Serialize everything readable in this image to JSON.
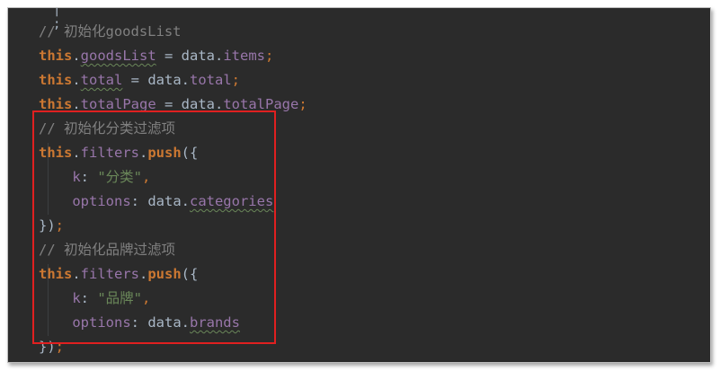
{
  "editor": {
    "lines": [
      {
        "id": "l1",
        "tokens": [
          {
            "c": "cm",
            "t": "// 初始化goodsList"
          }
        ]
      },
      {
        "id": "l2",
        "tokens": [
          {
            "c": "kw",
            "t": "this"
          },
          {
            "c": "pl",
            "t": "."
          },
          {
            "c": "pr sq",
            "t": "goodsList"
          },
          {
            "c": "pl",
            "t": " = data."
          },
          {
            "c": "pr",
            "t": "items"
          },
          {
            "c": "op",
            "t": ";"
          }
        ]
      },
      {
        "id": "l3",
        "tokens": [
          {
            "c": "kw",
            "t": "this"
          },
          {
            "c": "pl",
            "t": "."
          },
          {
            "c": "pr sq",
            "t": "total"
          },
          {
            "c": "pl",
            "t": " = data."
          },
          {
            "c": "pr",
            "t": "total"
          },
          {
            "c": "op",
            "t": ";"
          }
        ]
      },
      {
        "id": "l4",
        "tokens": [
          {
            "c": "kw",
            "t": "this"
          },
          {
            "c": "pl",
            "t": "."
          },
          {
            "c": "pr",
            "t": "totalPage"
          },
          {
            "c": "pl",
            "t": " = data."
          },
          {
            "c": "pr",
            "t": "totalPage"
          },
          {
            "c": "op",
            "t": ";"
          }
        ]
      },
      {
        "id": "l5",
        "tokens": [
          {
            "c": "cm",
            "t": "// 初始化分类过滤项"
          }
        ]
      },
      {
        "id": "l6",
        "tokens": [
          {
            "c": "kw",
            "t": "this"
          },
          {
            "c": "pl",
            "t": "."
          },
          {
            "c": "pr",
            "t": "filters"
          },
          {
            "c": "pl",
            "t": "."
          },
          {
            "c": "kw",
            "t": "push"
          },
          {
            "c": "pl",
            "t": "({"
          }
        ]
      },
      {
        "id": "l7",
        "tokens": [
          {
            "c": "pr",
            "t": "    k"
          },
          {
            "c": "pl",
            "t": ": "
          },
          {
            "c": "st",
            "t": "\"分类\""
          },
          {
            "c": "op",
            "t": ","
          }
        ]
      },
      {
        "id": "l8",
        "tokens": [
          {
            "c": "pr",
            "t": "    options"
          },
          {
            "c": "pl",
            "t": ": data."
          },
          {
            "c": "pr sq",
            "t": "categories"
          }
        ]
      },
      {
        "id": "l9",
        "tokens": [
          {
            "c": "pl",
            "t": "})"
          },
          {
            "c": "op",
            "t": ";"
          }
        ]
      },
      {
        "id": "l10",
        "tokens": [
          {
            "c": "cm",
            "t": "// 初始化品牌过滤项"
          }
        ]
      },
      {
        "id": "l11",
        "tokens": [
          {
            "c": "kw",
            "t": "this"
          },
          {
            "c": "pl",
            "t": "."
          },
          {
            "c": "pr",
            "t": "filters"
          },
          {
            "c": "pl",
            "t": "."
          },
          {
            "c": "kw",
            "t": "push"
          },
          {
            "c": "pl",
            "t": "({"
          }
        ]
      },
      {
        "id": "l12",
        "tokens": [
          {
            "c": "pr",
            "t": "    k"
          },
          {
            "c": "pl",
            "t": ": "
          },
          {
            "c": "st",
            "t": "\"品牌\""
          },
          {
            "c": "op",
            "t": ","
          }
        ]
      },
      {
        "id": "l13",
        "tokens": [
          {
            "c": "pr",
            "t": "    options"
          },
          {
            "c": "pl",
            "t": ": data."
          },
          {
            "c": "pr sq",
            "t": "brands"
          }
        ]
      },
      {
        "id": "l14",
        "tokens": [
          {
            "c": "pl",
            "t": "})"
          },
          {
            "c": "op",
            "t": ";"
          }
        ]
      }
    ],
    "top_fragment": "| ;"
  },
  "colors": {
    "background": "#2b2b2b",
    "keyword": "#cc7832",
    "property": "#9876aa",
    "string": "#6a8759",
    "comment": "#808080",
    "plain": "#a9b7c6",
    "highlight_border": "#e02020"
  }
}
